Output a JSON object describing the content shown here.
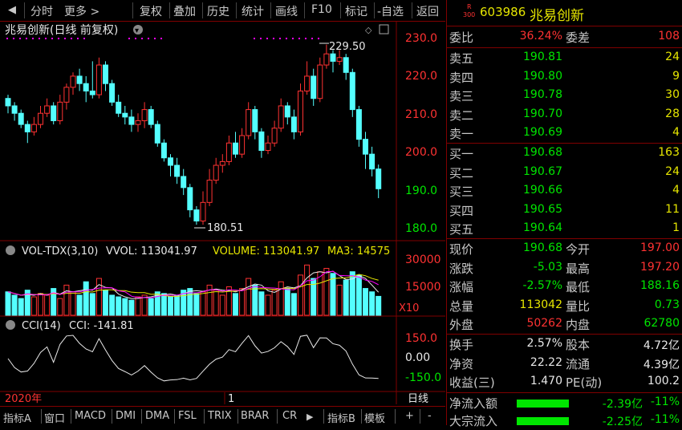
{
  "toolbar": {
    "items": [
      "分时",
      "更多 >",
      "复权",
      "叠加",
      "历史",
      "统计",
      "画线",
      "F10",
      "标记",
      "-自选",
      "返回"
    ]
  },
  "kline": {
    "title": "兆易创新(日线 前复权)",
    "high_label": "229.50",
    "low_label": "180.51",
    "yaxis_ticks": [
      "230.0",
      "220.0",
      "210.0",
      "200.0",
      "190.0",
      "180.0"
    ]
  },
  "volume_panel": {
    "indicator": "VOL-TDX(3,10)",
    "vvol": "VVOL: 113041.97",
    "volume": "VOLUME: 113041.97",
    "ma3": "MA3: 14575",
    "yaxis_ticks": [
      "30000",
      "15000"
    ],
    "unit": "X10"
  },
  "cci_panel": {
    "indicator": "CCI(14)",
    "cci_value": "CCI: -141.81",
    "yaxis_ticks": [
      "150.0",
      "0.00",
      "-150.0"
    ]
  },
  "timeline": {
    "year": "2020年",
    "month": "1",
    "period": "日线"
  },
  "bottombar": {
    "items": [
      "指标A",
      "窗口",
      "MACD",
      "DMI",
      "DMA",
      "FSL",
      "TRIX",
      "BRAR",
      "CR",
      "▶",
      "指标B",
      "模板",
      "+",
      "-"
    ]
  },
  "quote": {
    "badge_letter": "R",
    "badge_num": "300",
    "code": "603986",
    "name": "兆易创新",
    "weibi_label": "委比",
    "weibi": "36.24%",
    "weicha_label": "委差",
    "weicha": "108",
    "asks": [
      {
        "label": "卖五",
        "price": "190.81",
        "vol": "24"
      },
      {
        "label": "卖四",
        "price": "190.80",
        "vol": "9"
      },
      {
        "label": "卖三",
        "price": "190.78",
        "vol": "30"
      },
      {
        "label": "卖二",
        "price": "190.70",
        "vol": "28"
      },
      {
        "label": "卖一",
        "price": "190.69",
        "vol": "4"
      }
    ],
    "bids": [
      {
        "label": "买一",
        "price": "190.68",
        "vol": "163"
      },
      {
        "label": "买二",
        "price": "190.67",
        "vol": "24"
      },
      {
        "label": "买三",
        "price": "190.66",
        "vol": "4"
      },
      {
        "label": "买四",
        "price": "190.65",
        "vol": "11"
      },
      {
        "label": "买五",
        "price": "190.64",
        "vol": "1"
      }
    ],
    "stats": [
      {
        "l1": "现价",
        "v1": "190.68",
        "c1": "green",
        "l2": "今开",
        "v2": "197.00",
        "c2": "red"
      },
      {
        "l1": "涨跌",
        "v1": "-5.03",
        "c1": "green",
        "l2": "最高",
        "v2": "197.20",
        "c2": "red"
      },
      {
        "l1": "涨幅",
        "v1": "-2.57%",
        "c1": "green",
        "l2": "最低",
        "v2": "188.16",
        "c2": "green"
      },
      {
        "l1": "总量",
        "v1": "113042",
        "c1": "yellow",
        "l2": "量比",
        "v2": "0.73",
        "c2": "green"
      },
      {
        "l1": "外盘",
        "v1": "50262",
        "c1": "red",
        "l2": "内盘",
        "v2": "62780",
        "c2": "green"
      }
    ],
    "fund": [
      {
        "l1": "换手",
        "v1": "2.57%",
        "l2": "股本",
        "v2": "4.72亿"
      },
      {
        "l1": "净资",
        "v1": "22.22",
        "l2": "流通",
        "v2": "4.39亿"
      },
      {
        "l1": "收益(三)",
        "v1": "1.470",
        "l2": "PE(动)",
        "v2": "100.2"
      }
    ],
    "flow": [
      {
        "label": "净流入额",
        "value": "-2.39亿",
        "pct": "-11%"
      },
      {
        "label": "大宗流入",
        "value": "-2.25亿",
        "pct": "-11%"
      }
    ]
  },
  "chart_data": {
    "type": "candlestick",
    "candles": [
      [
        215,
        213,
        216,
        211
      ],
      [
        213,
        211,
        214,
        209
      ],
      [
        211,
        208,
        212,
        207
      ],
      [
        208,
        206,
        209,
        203
      ],
      [
        206,
        208,
        210,
        205
      ],
      [
        208,
        211,
        213,
        207
      ],
      [
        211,
        213,
        215,
        210
      ],
      [
        213,
        209,
        214,
        208
      ],
      [
        209,
        214,
        216,
        208
      ],
      [
        214,
        218,
        219,
        212
      ],
      [
        218,
        221,
        222,
        216
      ],
      [
        221,
        219,
        223,
        217
      ],
      [
        219,
        217,
        221,
        214
      ],
      [
        217,
        216,
        225,
        215
      ],
      [
        216,
        224,
        226,
        215
      ],
      [
        224,
        219,
        225,
        217
      ],
      [
        219,
        214,
        220,
        213
      ],
      [
        214,
        211,
        216,
        210
      ],
      [
        211,
        210,
        213,
        208
      ],
      [
        210,
        208,
        212,
        206
      ],
      [
        208,
        209,
        211,
        206
      ],
      [
        209,
        212,
        214,
        207
      ],
      [
        212,
        208,
        213,
        207
      ],
      [
        208,
        203,
        209,
        202
      ],
      [
        203,
        199,
        204,
        198
      ],
      [
        199,
        197,
        200,
        194
      ],
      [
        197,
        194,
        199,
        192
      ],
      [
        194,
        191,
        196,
        189
      ],
      [
        191,
        185,
        192,
        183
      ],
      [
        185,
        182,
        186,
        181
      ],
      [
        182,
        187,
        190,
        181
      ],
      [
        187,
        193,
        196,
        186
      ],
      [
        193,
        197,
        199,
        192
      ],
      [
        197,
        198,
        200,
        195
      ],
      [
        198,
        203,
        205,
        197
      ],
      [
        203,
        200,
        206,
        199
      ],
      [
        200,
        205,
        207,
        199
      ],
      [
        205,
        212,
        214,
        204
      ],
      [
        212,
        206,
        213,
        204
      ],
      [
        206,
        201,
        207,
        199
      ],
      [
        201,
        203,
        205,
        200
      ],
      [
        203,
        207,
        209,
        202
      ],
      [
        207,
        213,
        215,
        206
      ],
      [
        213,
        210,
        214,
        208
      ],
      [
        210,
        206,
        212,
        204
      ],
      [
        206,
        217,
        219,
        205
      ],
      [
        217,
        221,
        225,
        216
      ],
      [
        221,
        215,
        223,
        213
      ],
      [
        215,
        224,
        226,
        214
      ],
      [
        224,
        227,
        229.5,
        223
      ],
      [
        227,
        225,
        228,
        222
      ],
      [
        225,
        226,
        228,
        224
      ],
      [
        226,
        222,
        227,
        220
      ],
      [
        222,
        212,
        223,
        210
      ],
      [
        212,
        204,
        213,
        202
      ],
      [
        204,
        200,
        206,
        196
      ],
      [
        200,
        196,
        202,
        194
      ],
      [
        196,
        190.68,
        197.2,
        188.16
      ]
    ],
    "volumes": [
      14,
      12,
      10,
      15,
      11,
      13,
      12,
      16,
      10,
      18,
      14,
      12,
      20,
      13,
      22,
      15,
      12,
      11,
      10,
      9,
      11,
      12,
      10,
      14,
      13,
      11,
      12,
      15,
      16,
      13,
      14,
      18,
      15,
      12,
      17,
      13,
      16,
      22,
      18,
      14,
      12,
      15,
      20,
      16,
      13,
      24,
      30,
      22,
      26,
      28,
      25,
      18,
      21,
      26,
      24,
      16,
      14,
      11.3
    ],
    "yrange": [
      178,
      232
    ]
  }
}
